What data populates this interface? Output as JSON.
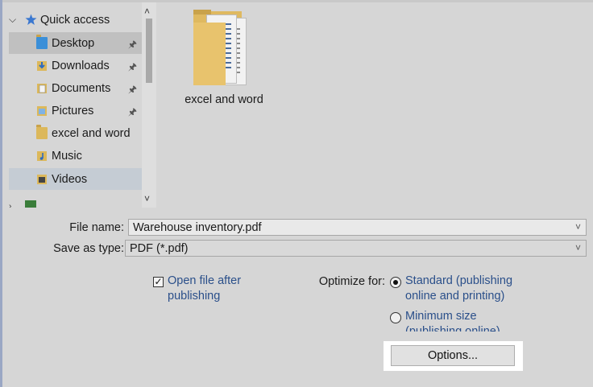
{
  "nav": {
    "quick_access": "Quick access",
    "items": [
      {
        "label": "Desktop"
      },
      {
        "label": "Downloads"
      },
      {
        "label": "Documents"
      },
      {
        "label": "Pictures"
      },
      {
        "label": "excel and word"
      },
      {
        "label": "Music"
      },
      {
        "label": "Videos"
      }
    ]
  },
  "files": [
    {
      "name": "excel and word"
    }
  ],
  "form": {
    "file_name_label": "File name:",
    "file_name_value": "Warehouse inventory.pdf",
    "save_type_label": "Save as type:",
    "save_type_value": "PDF (*.pdf)",
    "open_after_line1": "Open file after",
    "open_after_line2": "publishing",
    "open_after_checked": true,
    "optimize_label": "Optimize for:",
    "standard_line1": "Standard (publishing",
    "standard_line2": "online and printing)",
    "minimum_line1": "Minimum size",
    "minimum_line2": "(publishing online)",
    "options_button": "Options..."
  },
  "icons": [
    "chevron-down-icon",
    "star-icon",
    "folder-icon",
    "pin-icon",
    "download-arrow-icon",
    "documents-icon",
    "pictures-icon",
    "music-icon",
    "videos-icon",
    "checkmark-icon",
    "radio-icon"
  ],
  "colors": {
    "accent_link": "#2a4f8a",
    "folder": "#dcb85b",
    "selected_bg": "#c0c0c0"
  }
}
